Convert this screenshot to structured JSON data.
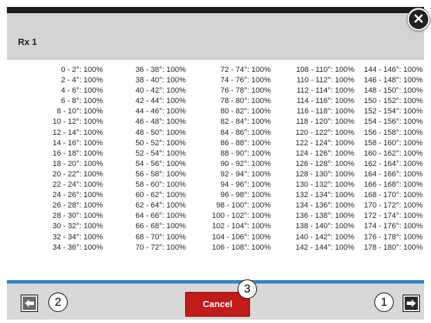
{
  "dialog": {
    "title": "Rx 1",
    "close_icon": "close-icon"
  },
  "columns": [
    [
      "0 - 2°: 100%",
      "2 - 4°: 100%",
      "4 - 6°: 100%",
      "6 - 8°: 100%",
      "8 - 10°: 100%",
      "10 - 12°: 100%",
      "12 - 14°: 100%",
      "14 - 16°: 100%",
      "16 - 18°: 100%",
      "18 - 20°: 100%",
      "20 - 22°: 100%",
      "22 - 24°: 100%",
      "24 - 26°: 100%",
      "26 - 28°: 100%",
      "28 - 30°: 100%",
      "30 - 32°: 100%",
      "32 - 34°: 100%",
      "34 - 36°: 100%"
    ],
    [
      "36 - 38°: 100%",
      "38 - 40°: 100%",
      "40 - 42°: 100%",
      "42 - 44°: 100%",
      "44 - 46°: 100%",
      "46 - 48°: 100%",
      "48 - 50°: 100%",
      "50 - 52°: 100%",
      "52 - 54°: 100%",
      "54 - 56°: 100%",
      "56 - 58°: 100%",
      "58 - 60°: 100%",
      "60 - 62°: 100%",
      "62 - 64°: 100%",
      "64 - 66°: 100%",
      "66 - 68°: 100%",
      "68 - 70°: 100%",
      "70 - 72°: 100%"
    ],
    [
      "72 - 74°: 100%",
      "74 - 76°: 100%",
      "76 - 78°: 100%",
      "78 - 80°: 100%",
      "80 - 82°: 100%",
      "82 - 84°: 100%",
      "84 - 86°: 100%",
      "86 - 88°: 100%",
      "88 - 90°: 100%",
      "90 - 92°: 100%",
      "92 - 94°: 100%",
      "94 - 96°: 100%",
      "96 - 98°: 100%",
      "98 - 100°: 100%",
      "100 - 102°: 100%",
      "102 - 104°: 100%",
      "104 - 106°: 100%",
      "106 - 108°: 100%"
    ],
    [
      "108 - 110°: 100%",
      "110 - 112°: 100%",
      "112 - 114°: 100%",
      "114 - 116°: 100%",
      "116 - 118°: 100%",
      "118 - 120°: 100%",
      "120 - 122°: 100%",
      "122 - 124°: 100%",
      "124 - 126°: 100%",
      "126 - 128°: 100%",
      "128 - 130°: 100%",
      "130 - 132°: 100%",
      "132 - 134°: 100%",
      "134 - 136°: 100%",
      "136 - 138°: 100%",
      "138 - 140°: 100%",
      "140 - 142°: 100%",
      "142 - 144°: 100%"
    ],
    [
      "144 - 146°: 100%",
      "146 - 148°: 100%",
      "148 - 150°: 100%",
      "150 - 152°: 100%",
      "152 - 154°: 100%",
      "154 - 156°: 100%",
      "156 - 158°: 100%",
      "158 - 160°: 100%",
      "160 - 162°: 100%",
      "162 - 164°: 100%",
      "164 - 166°: 100%",
      "166 - 168°: 100%",
      "168 - 170°: 100%",
      "170 - 172°: 100%",
      "172 - 174°: 100%",
      "174 - 176°: 100%",
      "176 - 178°: 100%",
      "178 - 180°: 100%"
    ]
  ],
  "footer": {
    "cancel_label": "Cancel",
    "prev_icon": "arrow-left-icon",
    "next_icon": "arrow-right-icon"
  },
  "callouts": {
    "one": "1",
    "two": "2",
    "three": "3"
  },
  "colors": {
    "accent_rule": "#2f86c4",
    "cancel": "#c21b1b",
    "header": "#d4d4d4",
    "footer": "#d8d8d8"
  }
}
